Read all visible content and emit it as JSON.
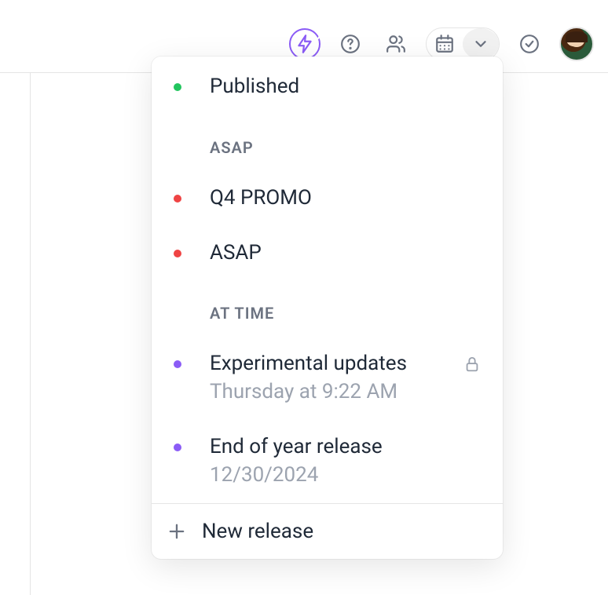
{
  "header": {
    "lightning": "lightning",
    "help": "help",
    "people": "people",
    "calendar": "calendar",
    "chevron": "chevron-down",
    "check": "check",
    "avatar": "user-avatar"
  },
  "dropdown": {
    "items": [
      {
        "status": "green",
        "title": "Published"
      }
    ],
    "sections": [
      {
        "label": "ASAP",
        "items": [
          {
            "status": "red",
            "title": "Q4 PROMO"
          },
          {
            "status": "red",
            "title": "ASAP"
          }
        ]
      },
      {
        "label": "AT TIME",
        "items": [
          {
            "status": "purple",
            "title": "Experimental updates",
            "subtitle": "Thursday at 9:22 AM",
            "locked": true
          },
          {
            "status": "purple",
            "title": "End of year release",
            "subtitle": "12/30/2024"
          }
        ]
      }
    ],
    "footer": {
      "label": "New release"
    }
  }
}
